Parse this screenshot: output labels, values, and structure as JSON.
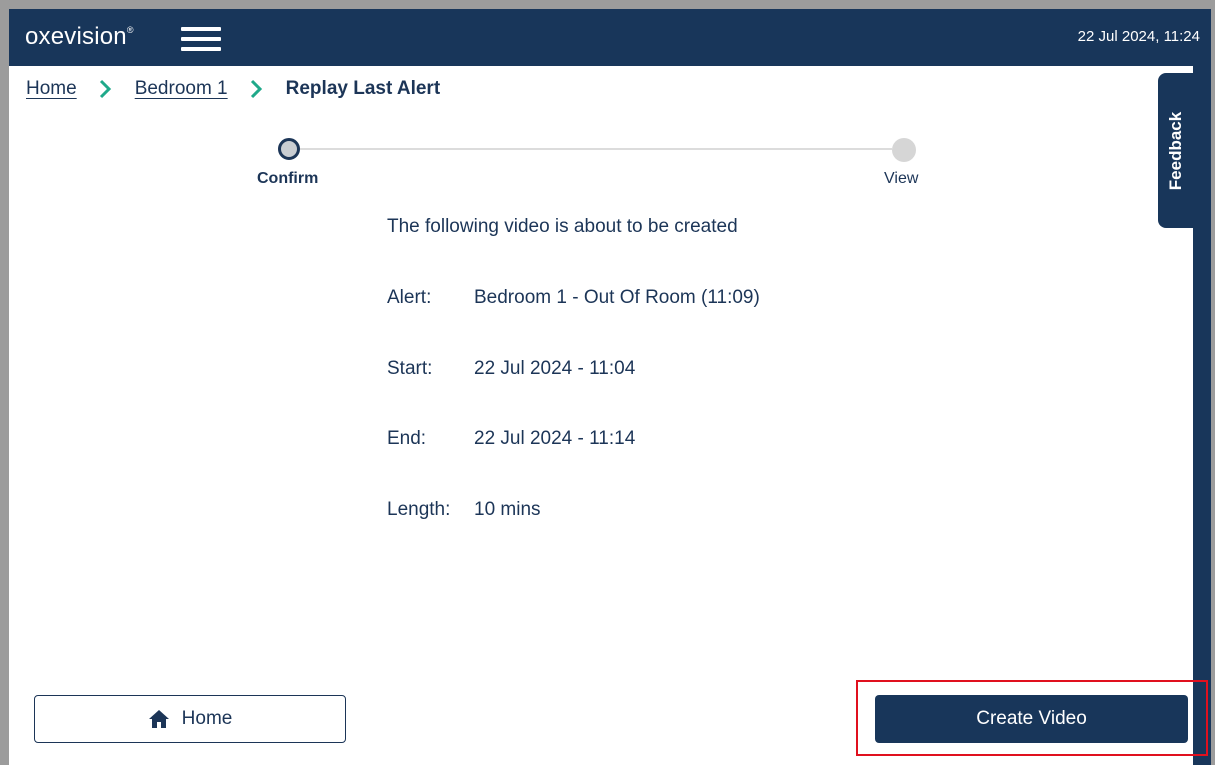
{
  "header": {
    "logo_text": "oxevision",
    "logo_mark": "®",
    "datetime": "22 Jul 2024, 11:24",
    "menu_icon": "hamburger-menu-icon"
  },
  "breadcrumb": {
    "items": [
      "Home",
      "Bedroom 1"
    ],
    "current": "Replay Last Alert",
    "separator_icon": "chevron-right-icon",
    "separator_color": "#1fa98a"
  },
  "feedback": {
    "label": "Feedback"
  },
  "stepper": {
    "steps": [
      {
        "label": "Confirm",
        "state": "active"
      },
      {
        "label": "View",
        "state": "inactive"
      }
    ]
  },
  "details": {
    "intro": "The following video is about to be created",
    "rows": [
      {
        "label": "Alert:",
        "value": "Bedroom 1 - Out Of Room (11:09)"
      },
      {
        "label": "Start:",
        "value": "22 Jul 2024 - 11:04"
      },
      {
        "label": "End:",
        "value": "22 Jul 2024 - 11:14"
      },
      {
        "label": "Length:",
        "value": "10 mins"
      }
    ]
  },
  "actions": {
    "home_label": "Home",
    "home_icon": "home-icon",
    "create_label": "Create Video"
  },
  "colors": {
    "primary": "#18365a",
    "highlight": "#e0101e",
    "accent": "#1fa98a"
  }
}
